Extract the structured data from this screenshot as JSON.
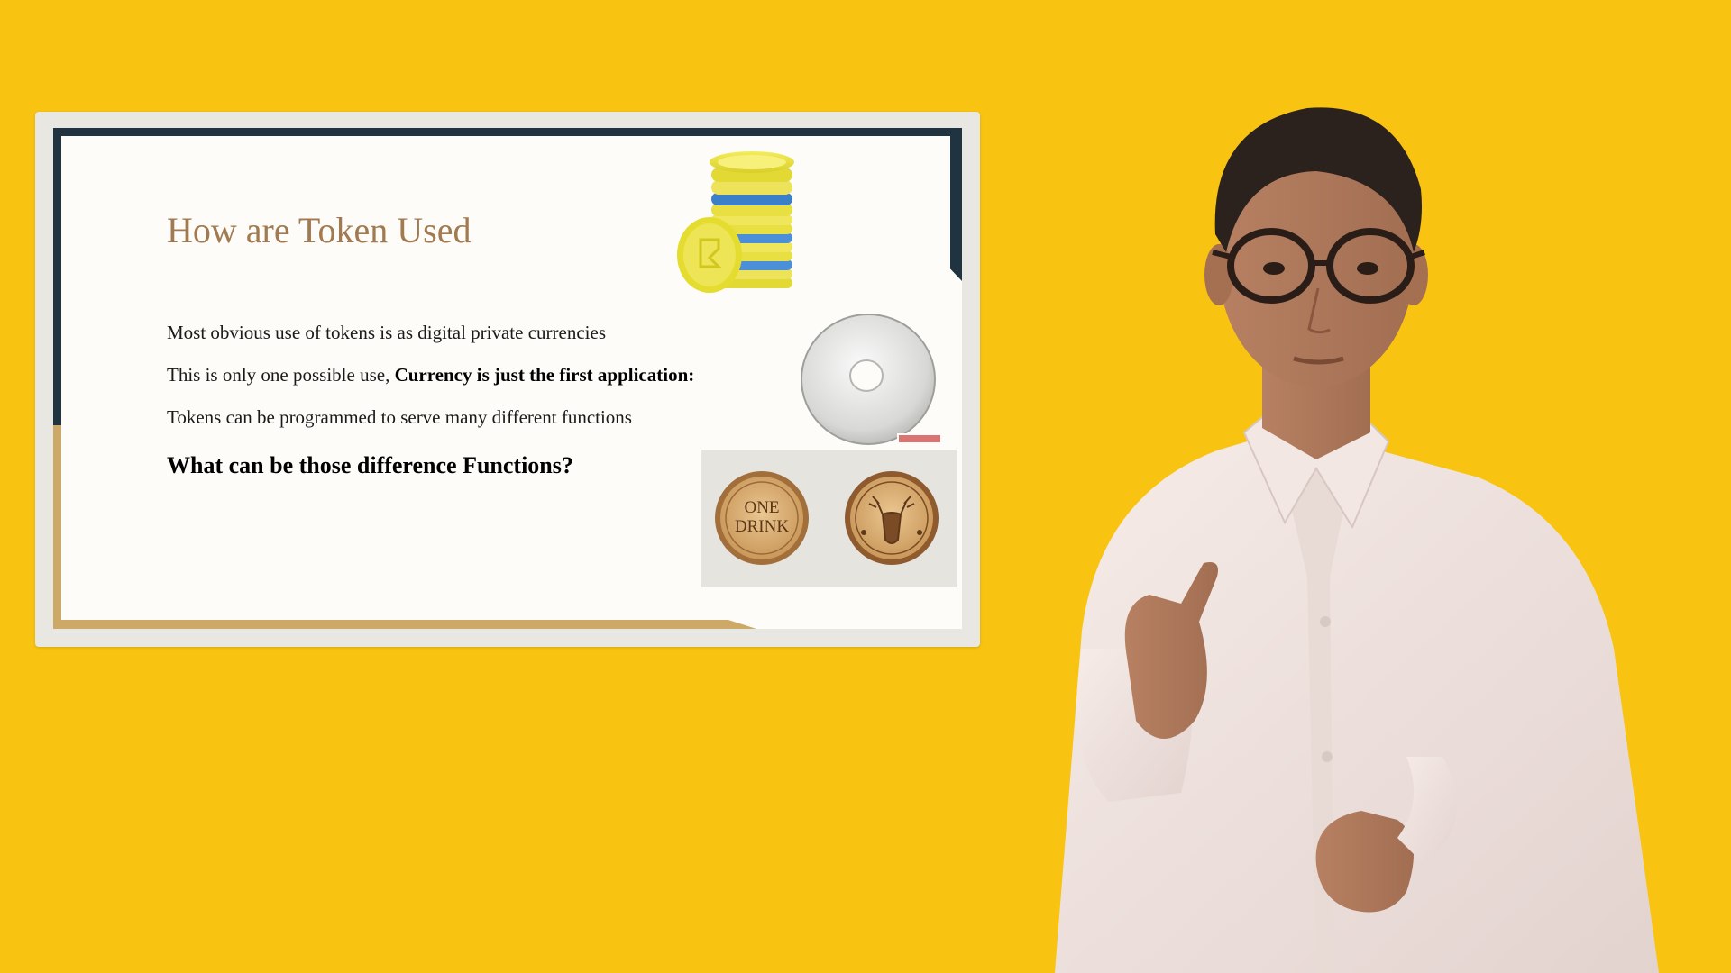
{
  "slide": {
    "title": "How are Token Used",
    "bullets": [
      {
        "text": "Most obvious use of tokens is as digital private currencies",
        "bold": ""
      },
      {
        "text": "This is only one possible use, ",
        "bold": "Currency is just the first application:"
      },
      {
        "text": "Tokens can be programmed to serve many different functions",
        "bold": ""
      }
    ],
    "question": "What can be those difference Functions?",
    "coin_text": {
      "line1": "ONE",
      "line2": "DRINK"
    }
  },
  "colors": {
    "background": "#f9c411",
    "frame": "#e9e7e1",
    "navy_accent": "#1f3340",
    "gold_accent": "#cda967",
    "title": "#a17a51"
  },
  "icons": [
    "coin-stack-icon",
    "washer-token-icon",
    "drink-token-icon",
    "presenter-figure"
  ]
}
